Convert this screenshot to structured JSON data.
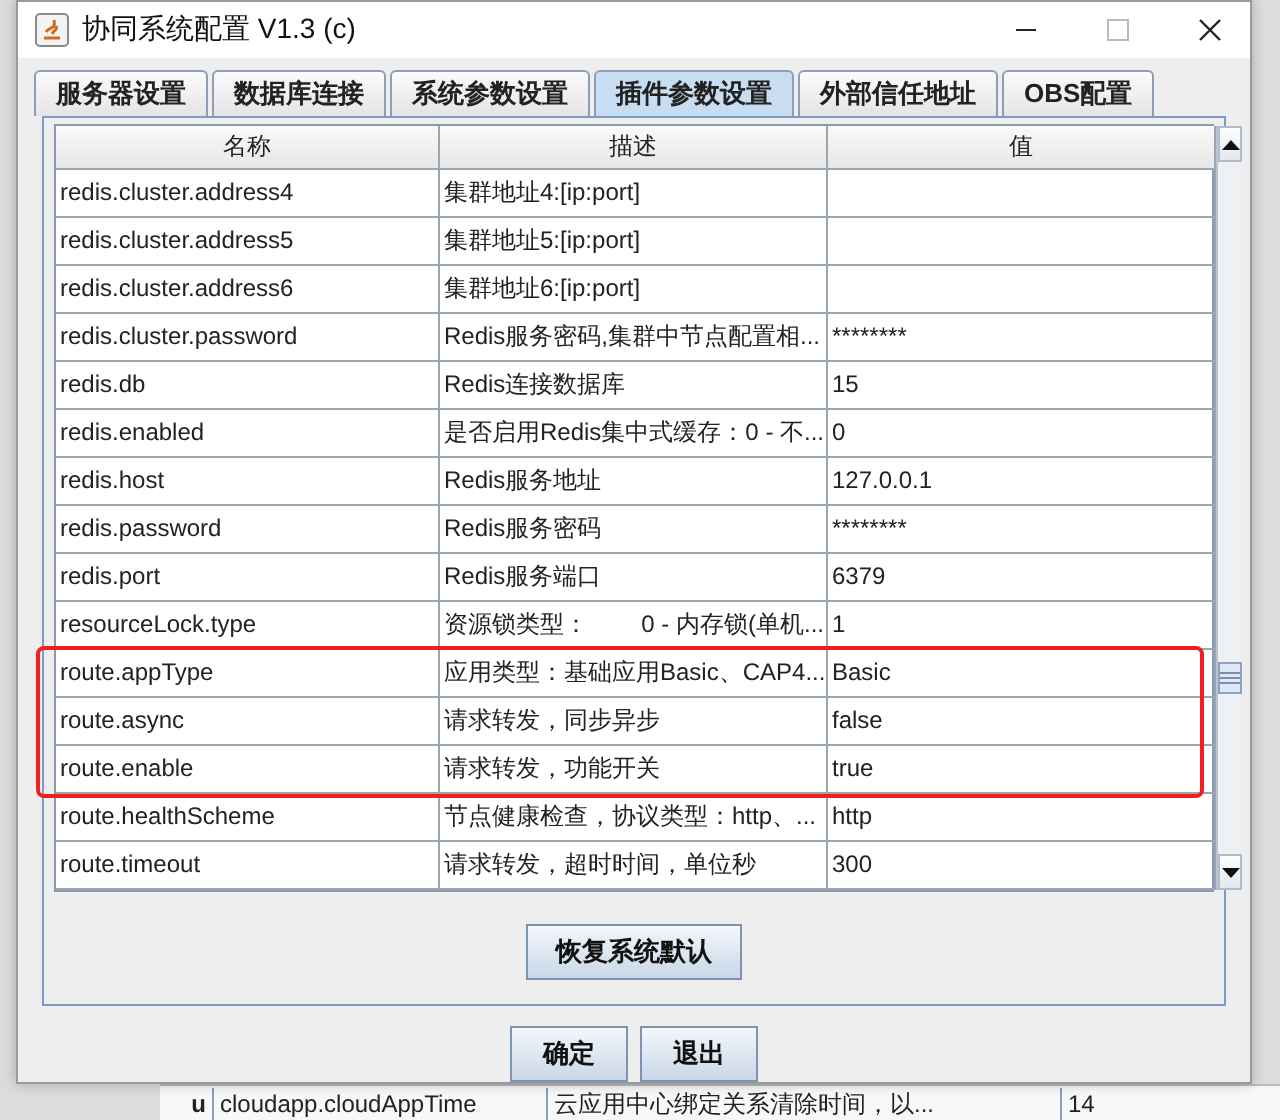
{
  "window": {
    "title": "协同系统配置 V1.3 (c)"
  },
  "tabs": [
    {
      "label": "服务器设置",
      "selected": false
    },
    {
      "label": "数据库连接",
      "selected": false
    },
    {
      "label": "系统参数设置",
      "selected": false
    },
    {
      "label": "插件参数设置",
      "selected": true
    },
    {
      "label": "外部信任地址",
      "selected": false
    },
    {
      "label": "OBS配置",
      "selected": false
    }
  ],
  "table": {
    "columns": [
      "名称",
      "描述",
      "值"
    ],
    "rows": [
      {
        "name": "redis.cluster.address4",
        "description": "集群地址4:[ip:port]",
        "value": "",
        "highlighted": false
      },
      {
        "name": "redis.cluster.address5",
        "description": "集群地址5:[ip:port]",
        "value": "",
        "highlighted": false
      },
      {
        "name": "redis.cluster.address6",
        "description": "集群地址6:[ip:port]",
        "value": "",
        "highlighted": false
      },
      {
        "name": "redis.cluster.password",
        "description": "Redis服务密码,集群中节点配置相...",
        "value": "********",
        "highlighted": false
      },
      {
        "name": "redis.db",
        "description": "Redis连接数据库",
        "value": "15",
        "highlighted": false
      },
      {
        "name": "redis.enabled",
        "description": "是否启用Redis集中式缓存：0 - 不...",
        "value": "0",
        "highlighted": false
      },
      {
        "name": "redis.host",
        "description": "Redis服务地址",
        "value": "127.0.0.1",
        "highlighted": false
      },
      {
        "name": "redis.password",
        "description": "Redis服务密码",
        "value": "********",
        "highlighted": false
      },
      {
        "name": "redis.port",
        "description": "Redis服务端口",
        "value": "6379",
        "highlighted": false
      },
      {
        "name": "resourceLock.type",
        "description": "资源锁类型：        0 - 内存锁(单机...",
        "value": "1",
        "highlighted": false
      },
      {
        "name": "route.appType",
        "description": "应用类型：基础应用Basic、CAP4...",
        "value": "Basic",
        "highlighted": true
      },
      {
        "name": "route.async",
        "description": "请求转发，同步异步",
        "value": "false",
        "highlighted": true
      },
      {
        "name": "route.enable",
        "description": "请求转发，功能开关",
        "value": "true",
        "highlighted": true
      },
      {
        "name": "route.healthScheme",
        "description": "节点健康检查，协议类型：http、...",
        "value": "http",
        "highlighted": false
      },
      {
        "name": "route.timeout",
        "description": "请求转发，超时时间，单位秒",
        "value": "300",
        "highlighted": false
      }
    ]
  },
  "restore_button": "恢复系统默认",
  "buttons": [
    "确定",
    "退出"
  ],
  "background_window": {
    "cells": [
      "u",
      "cloudapp.cloudAppTime",
      "云应用中心绑定关系清除时间，以...",
      "14"
    ]
  }
}
